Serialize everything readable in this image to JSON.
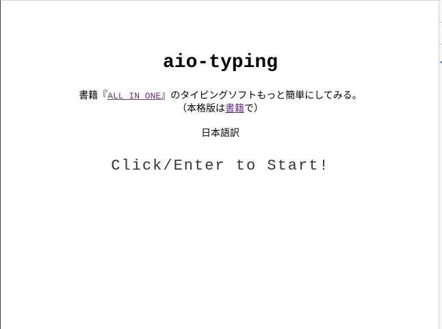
{
  "page": {
    "title": "aio-typing",
    "description": {
      "prefix": "書籍『",
      "link_text": "ALL IN ONE",
      "suffix": "』のタイピングソフトもっと簡単にしてみる。",
      "line2_prefix": "（本格版は",
      "line2_link": "書籍",
      "line2_suffix": "で）"
    },
    "language_label": "日本語訳",
    "start_prompt": "Click/Enter to Start!"
  },
  "side_panel": {
    "arrow_icon": "left-arrow-icon"
  }
}
